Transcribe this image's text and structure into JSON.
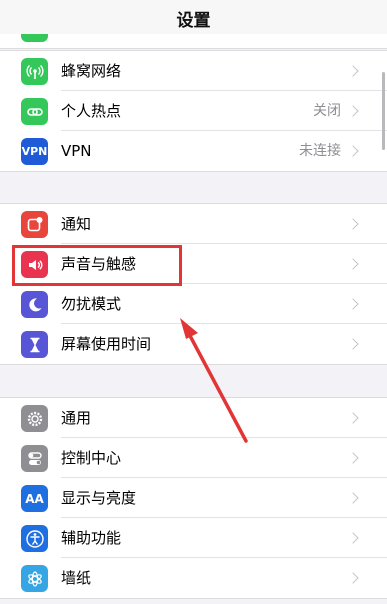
{
  "header": {
    "title": "设置"
  },
  "group1": {
    "items": [
      {
        "label": "蜂窝网络",
        "value": "",
        "icon": "antenna-icon",
        "color": "#34c759"
      },
      {
        "label": "个人热点",
        "value": "关闭",
        "icon": "link-chain-icon",
        "color": "#34c759"
      },
      {
        "label": "VPN",
        "value": "未连接",
        "icon": "vpn-icon",
        "color": "#1f5bd6",
        "icon_text": "VPN"
      }
    ]
  },
  "group2": {
    "items": [
      {
        "label": "通知",
        "value": "",
        "icon": "notification-icon",
        "color": "#e8453c"
      },
      {
        "label": "声音与触感",
        "value": "",
        "icon": "speaker-icon",
        "color": "#e9344f"
      },
      {
        "label": "勿扰模式",
        "value": "",
        "icon": "moon-icon",
        "color": "#5856d6"
      },
      {
        "label": "屏幕使用时间",
        "value": "",
        "icon": "hourglass-icon",
        "color": "#5856d6"
      }
    ]
  },
  "group3": {
    "items": [
      {
        "label": "通用",
        "value": "",
        "icon": "gear-icon",
        "color": "#8e8e93"
      },
      {
        "label": "控制中心",
        "value": "",
        "icon": "toggle-switches-icon",
        "color": "#8e8e93"
      },
      {
        "label": "显示与亮度",
        "value": "",
        "icon": "text-size-icon",
        "color": "#1f6fe0",
        "icon_text": "AA"
      },
      {
        "label": "辅助功能",
        "value": "",
        "icon": "accessibility-icon",
        "color": "#1f6fe0"
      },
      {
        "label": "墙纸",
        "value": "",
        "icon": "flower-icon",
        "color": "#35a6e3"
      }
    ]
  },
  "annotation": {
    "highlight_color": "#e23535"
  }
}
